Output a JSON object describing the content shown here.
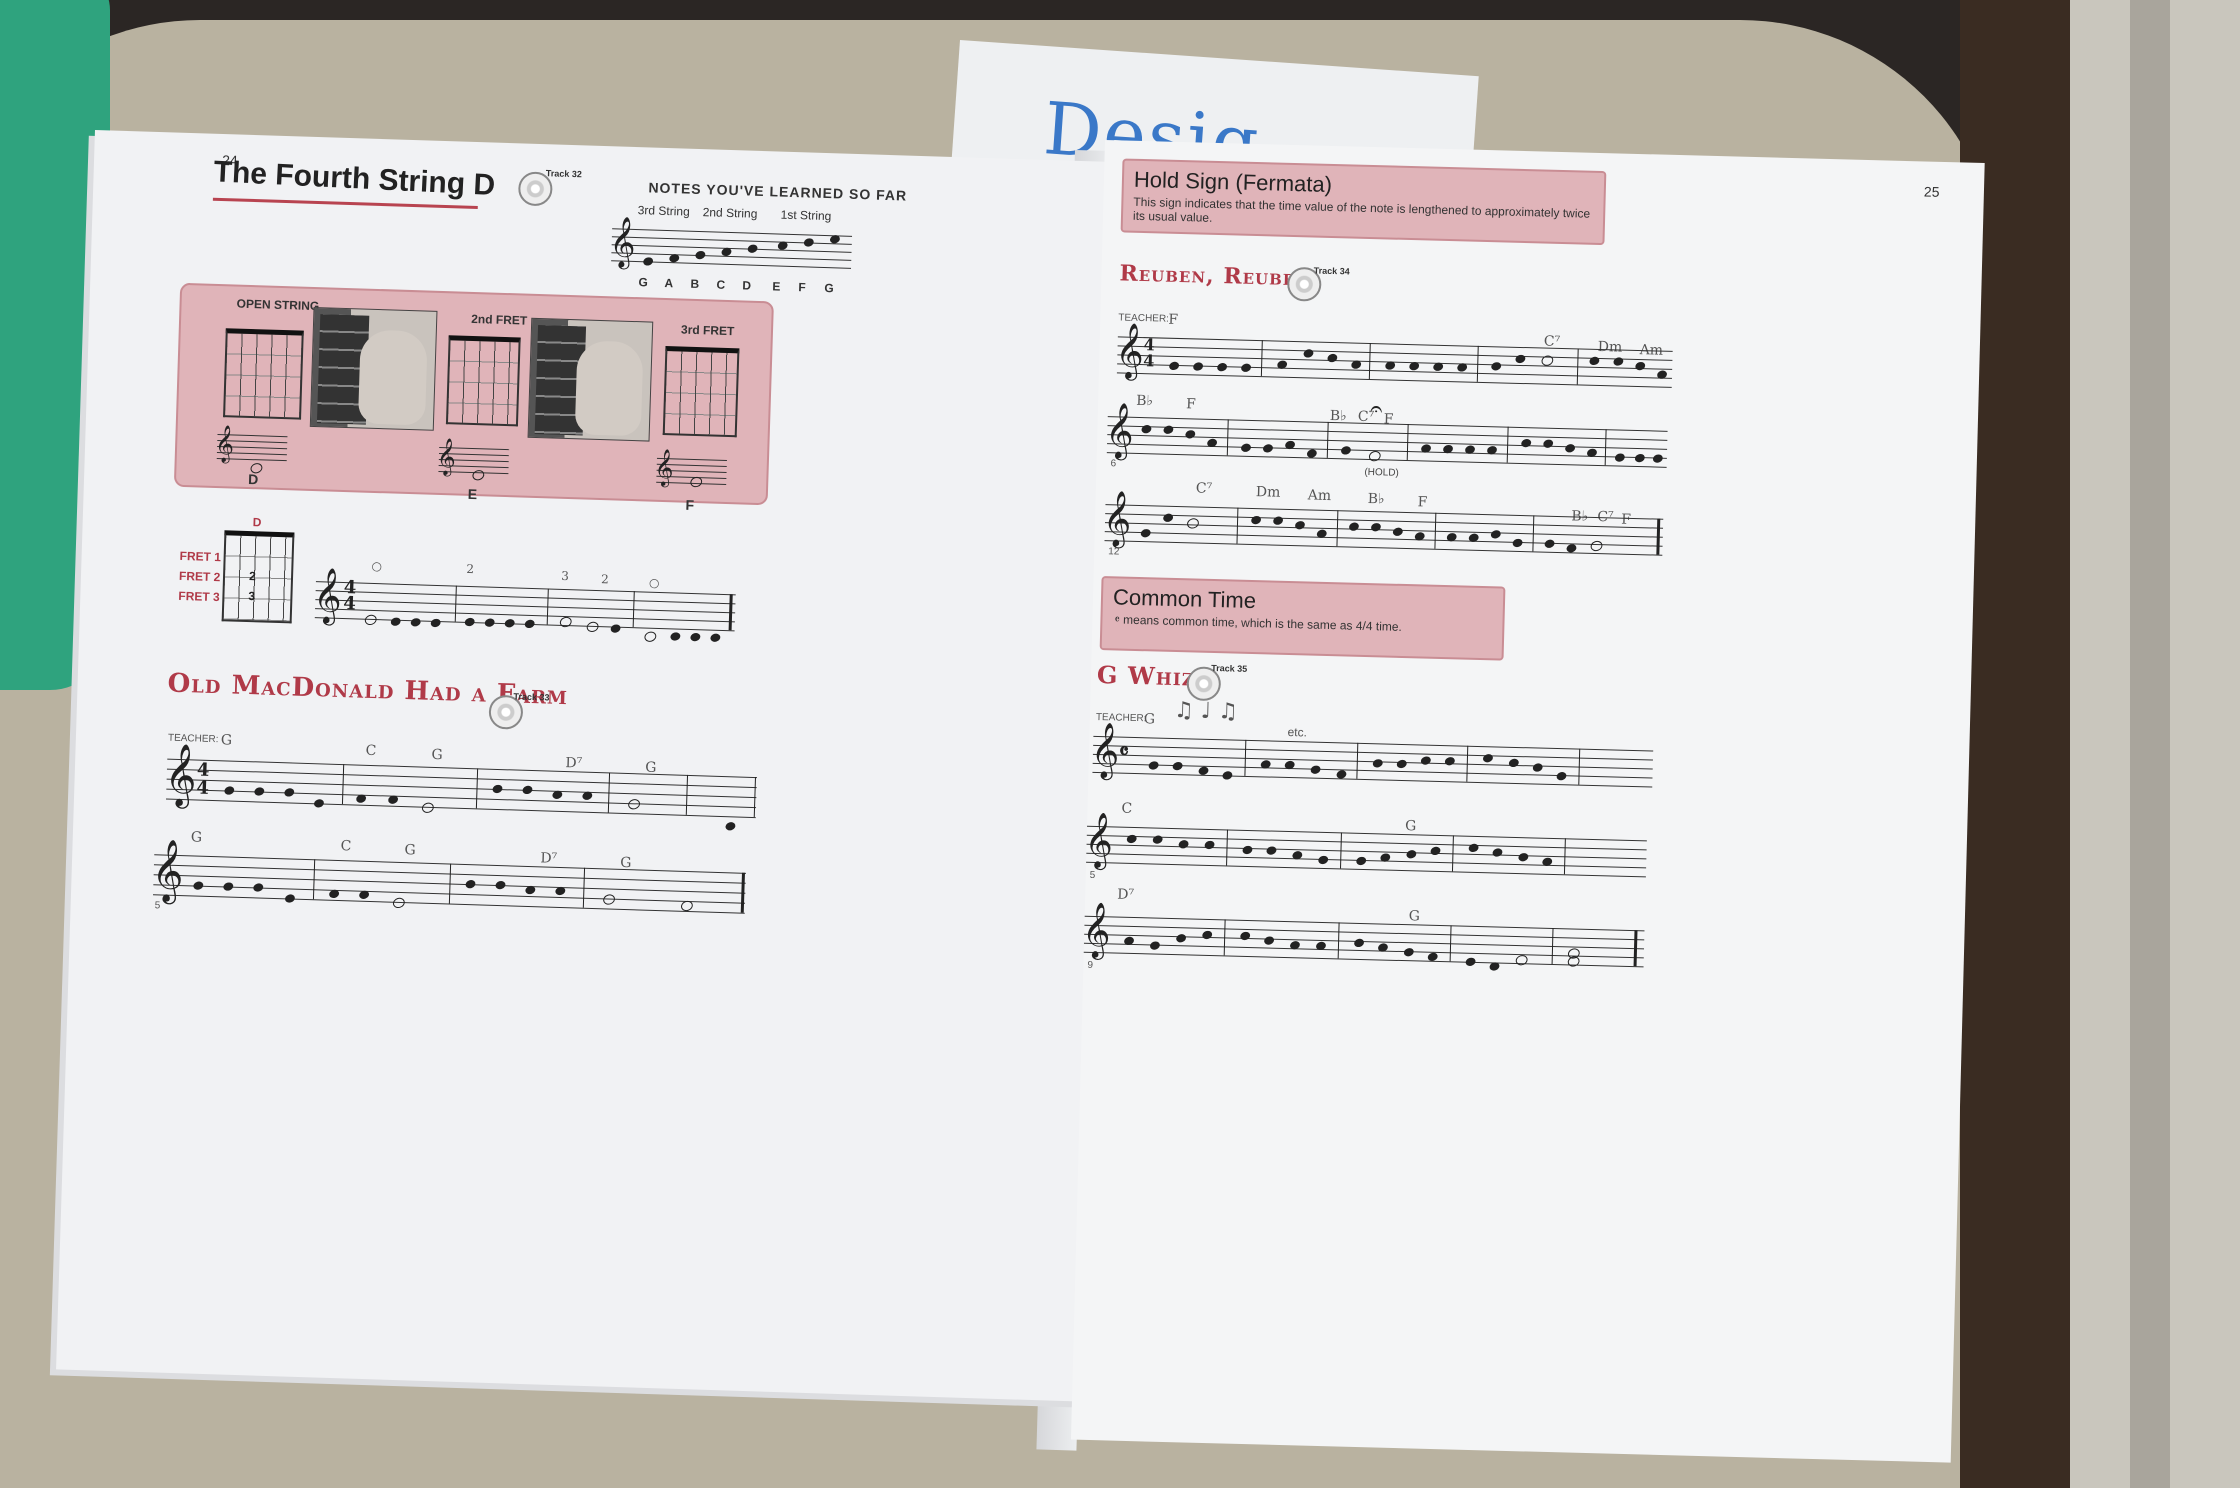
{
  "background_book": {
    "title_fragment": "Desig"
  },
  "left_page": {
    "page_number": "24",
    "title": "The Fourth String D",
    "track": "Track 32",
    "notes_learned": {
      "heading": "NOTES YOU'VE LEARNED SO FAR",
      "strings": [
        "3rd String",
        "2nd String",
        "1st String"
      ],
      "note_names": [
        "G",
        "A",
        "B",
        "C",
        "D",
        "E",
        "F",
        "G"
      ]
    },
    "fret_panel": {
      "labels": [
        "OPEN STRING",
        "2nd FRET",
        "3rd FRET"
      ],
      "notes": [
        "D",
        "E",
        "F"
      ]
    },
    "fret_chart": {
      "top_label": "D",
      "frets": [
        "FRET 1",
        "FRET 2",
        "FRET 3"
      ],
      "markers": [
        "2",
        "3"
      ]
    },
    "exercise": {
      "time_signature": "4/4",
      "finger_numbers": [
        "○",
        "2",
        "3",
        "2",
        "○"
      ]
    },
    "song": {
      "title": "Old MacDonald Had a Farm",
      "track": "Track 33",
      "teacher": "TEACHER:",
      "row1_chords": [
        "G",
        "C",
        "G",
        "D⁷",
        "G"
      ],
      "row2_chords": [
        "G",
        "C",
        "G",
        "D⁷",
        "G"
      ],
      "measure_number": "5"
    }
  },
  "right_page": {
    "page_number": "25",
    "hold_sign": {
      "title": "Hold Sign (Fermata)",
      "text": "This sign indicates that the time value of the note is lengthened to approximately twice its usual value."
    },
    "song1": {
      "title": "Reuben, Reuben",
      "track": "Track 34",
      "teacher": "TEACHER:",
      "row1_chords": [
        "F",
        "C⁷",
        "Dm",
        "Am"
      ],
      "row2_chords": [
        "B♭",
        "F",
        "B♭",
        "C⁷",
        "F"
      ],
      "row3_chords": [
        "C⁷",
        "Dm",
        "Am",
        "B♭",
        "F",
        "B♭",
        "C⁷",
        "F"
      ],
      "hold_label": "(HOLD)",
      "measure_numbers": [
        "6",
        "12"
      ]
    },
    "common_time": {
      "title": "Common Time",
      "text": "means common time, which is the same as 4/4 time."
    },
    "song2": {
      "title": "G Whiz",
      "track": "Track 35",
      "teacher": "TEACHER:",
      "teacher_chord": "G",
      "etc": "etc.",
      "row2_chords": [
        "C",
        "G"
      ],
      "row3_chords": [
        "D⁷",
        "G"
      ],
      "measure_numbers": [
        "5",
        "9"
      ]
    }
  }
}
